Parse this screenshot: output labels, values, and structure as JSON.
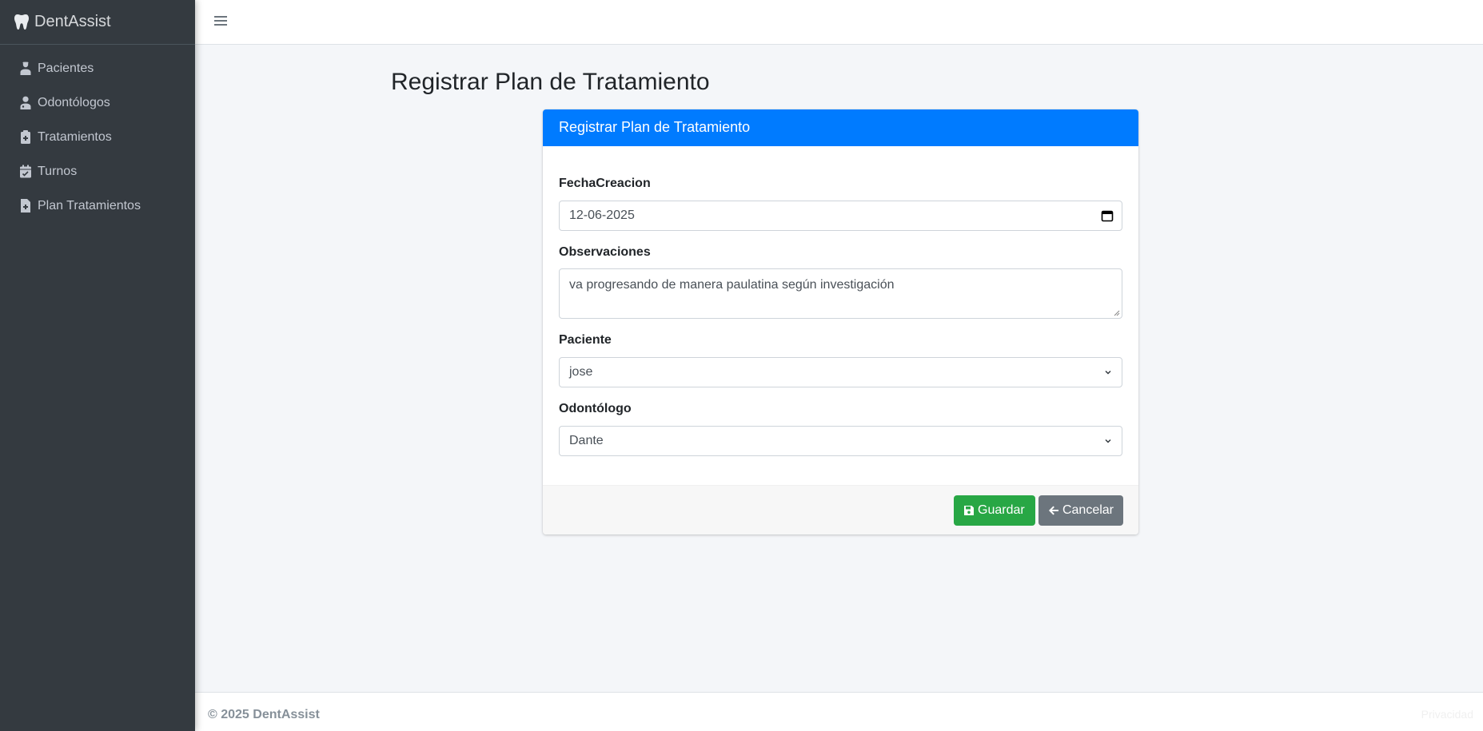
{
  "app": {
    "brand": "DentAssist"
  },
  "sidebar": {
    "items": [
      {
        "label": "Pacientes",
        "icon": "user-injured-icon"
      },
      {
        "label": "Odontólogos",
        "icon": "user-doctor-icon"
      },
      {
        "label": "Tratamientos",
        "icon": "clipboard-medical-icon"
      },
      {
        "label": "Turnos",
        "icon": "calendar-check-icon"
      },
      {
        "label": "Plan Tratamientos",
        "icon": "file-medical-icon"
      }
    ]
  },
  "page": {
    "title": "Registrar Plan de Tratamiento"
  },
  "form": {
    "header": "Registrar Plan de Tratamiento",
    "fecha": {
      "label": "FechaCreacion",
      "value": "12-06-2025"
    },
    "observaciones": {
      "label": "Observaciones",
      "value": "va progresando de manera paulatina según investigación"
    },
    "paciente": {
      "label": "Paciente",
      "value": "jose"
    },
    "odontologo": {
      "label": "Odontólogo",
      "value": "Dante"
    },
    "save_label": "Guardar",
    "cancel_label": "Cancelar"
  },
  "footer": {
    "copyright": "© 2025 DentAssist",
    "right_text": "Privacidad"
  },
  "colors": {
    "primary": "#007bff",
    "success": "#28a745",
    "secondary": "#6c757d",
    "sidebar": "#343a40"
  }
}
